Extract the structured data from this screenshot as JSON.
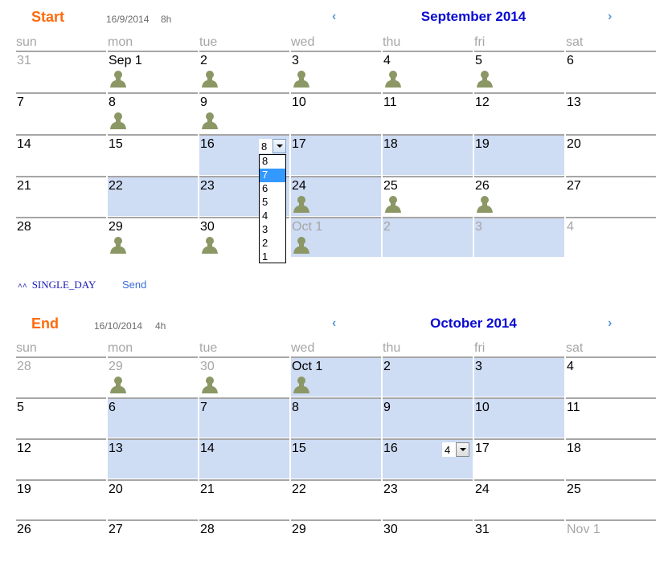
{
  "start": {
    "title": "Start",
    "date": "16/9/2014",
    "hours": "8h",
    "nav_prev": "‹",
    "nav_next": "›",
    "month": "September 2014",
    "weekdays": [
      "sun",
      "mon",
      "tue",
      "wed",
      "thu",
      "fri",
      "sat"
    ],
    "rows": [
      [
        {
          "label": "31",
          "other": true,
          "sel": false,
          "person": false
        },
        {
          "label": "Sep 1",
          "other": false,
          "sel": false,
          "person": true
        },
        {
          "label": "2",
          "other": false,
          "sel": false,
          "person": true
        },
        {
          "label": "3",
          "other": false,
          "sel": false,
          "person": true
        },
        {
          "label": "4",
          "other": false,
          "sel": false,
          "person": true
        },
        {
          "label": "5",
          "other": false,
          "sel": false,
          "person": true
        },
        {
          "label": "6",
          "other": false,
          "sel": false,
          "person": false
        }
      ],
      [
        {
          "label": "7",
          "other": false,
          "sel": false,
          "person": false
        },
        {
          "label": "8",
          "other": false,
          "sel": false,
          "person": true
        },
        {
          "label": "9",
          "other": false,
          "sel": false,
          "person": true
        },
        {
          "label": "10",
          "other": false,
          "sel": false,
          "person": false
        },
        {
          "label": "11",
          "other": false,
          "sel": false,
          "person": false
        },
        {
          "label": "12",
          "other": false,
          "sel": false,
          "person": false
        },
        {
          "label": "13",
          "other": false,
          "sel": false,
          "person": false
        }
      ],
      [
        {
          "label": "14",
          "other": false,
          "sel": false,
          "person": false
        },
        {
          "label": "15",
          "other": false,
          "sel": false,
          "person": false
        },
        {
          "label": "16",
          "other": false,
          "sel": true,
          "person": false
        },
        {
          "label": "17",
          "other": false,
          "sel": true,
          "person": false
        },
        {
          "label": "18",
          "other": false,
          "sel": true,
          "person": false
        },
        {
          "label": "19",
          "other": false,
          "sel": true,
          "person": false
        },
        {
          "label": "20",
          "other": false,
          "sel": false,
          "person": false
        }
      ],
      [
        {
          "label": "21",
          "other": false,
          "sel": false,
          "person": false
        },
        {
          "label": "22",
          "other": false,
          "sel": true,
          "person": false
        },
        {
          "label": "23",
          "other": false,
          "sel": true,
          "person": false
        },
        {
          "label": "24",
          "other": false,
          "sel": true,
          "person": true
        },
        {
          "label": "25",
          "other": false,
          "sel": false,
          "person": true
        },
        {
          "label": "26",
          "other": false,
          "sel": false,
          "person": true
        },
        {
          "label": "27",
          "other": false,
          "sel": false,
          "person": false
        }
      ],
      [
        {
          "label": "28",
          "other": false,
          "sel": false,
          "person": false
        },
        {
          "label": "29",
          "other": false,
          "sel": false,
          "person": true
        },
        {
          "label": "30",
          "other": false,
          "sel": false,
          "person": true
        },
        {
          "label": "Oct 1",
          "other": true,
          "sel": true,
          "person": true
        },
        {
          "label": "2",
          "other": true,
          "sel": true,
          "person": false
        },
        {
          "label": "3",
          "other": true,
          "sel": true,
          "person": false
        },
        {
          "label": "4",
          "other": true,
          "sel": false,
          "person": false
        }
      ]
    ],
    "hours_select": {
      "value": "8",
      "options": [
        "8",
        "7",
        "6",
        "5",
        "4",
        "3",
        "2",
        "1"
      ],
      "highlighted": "7"
    }
  },
  "footer": {
    "mode_icon": "double-chevron-up-icon",
    "mode_label": "SINGLE_DAY",
    "send_label": "Send"
  },
  "end": {
    "title": "End",
    "date": "16/10/2014",
    "hours": "4h",
    "nav_prev": "‹",
    "nav_next": "›",
    "month": "October 2014",
    "weekdays": [
      "sun",
      "mon",
      "tue",
      "wed",
      "thu",
      "fri",
      "sat"
    ],
    "rows": [
      [
        {
          "label": "28",
          "other": true,
          "sel": false,
          "person": false
        },
        {
          "label": "29",
          "other": true,
          "sel": false,
          "person": true
        },
        {
          "label": "30",
          "other": true,
          "sel": false,
          "person": true
        },
        {
          "label": "Oct 1",
          "other": false,
          "sel": true,
          "person": true
        },
        {
          "label": "2",
          "other": false,
          "sel": true,
          "person": false
        },
        {
          "label": "3",
          "other": false,
          "sel": true,
          "person": false
        },
        {
          "label": "4",
          "other": false,
          "sel": false,
          "person": false
        }
      ],
      [
        {
          "label": "5",
          "other": false,
          "sel": false,
          "person": false
        },
        {
          "label": "6",
          "other": false,
          "sel": true,
          "person": false
        },
        {
          "label": "7",
          "other": false,
          "sel": true,
          "person": false
        },
        {
          "label": "8",
          "other": false,
          "sel": true,
          "person": false
        },
        {
          "label": "9",
          "other": false,
          "sel": true,
          "person": false
        },
        {
          "label": "10",
          "other": false,
          "sel": true,
          "person": false
        },
        {
          "label": "11",
          "other": false,
          "sel": false,
          "person": false
        }
      ],
      [
        {
          "label": "12",
          "other": false,
          "sel": false,
          "person": false
        },
        {
          "label": "13",
          "other": false,
          "sel": true,
          "person": false
        },
        {
          "label": "14",
          "other": false,
          "sel": true,
          "person": false
        },
        {
          "label": "15",
          "other": false,
          "sel": true,
          "person": false
        },
        {
          "label": "16",
          "other": false,
          "sel": true,
          "person": false
        },
        {
          "label": "17",
          "other": false,
          "sel": false,
          "person": false
        },
        {
          "label": "18",
          "other": false,
          "sel": false,
          "person": false
        }
      ],
      [
        {
          "label": "19",
          "other": false,
          "sel": false,
          "person": false
        },
        {
          "label": "20",
          "other": false,
          "sel": false,
          "person": false
        },
        {
          "label": "21",
          "other": false,
          "sel": false,
          "person": false
        },
        {
          "label": "22",
          "other": false,
          "sel": false,
          "person": false
        },
        {
          "label": "23",
          "other": false,
          "sel": false,
          "person": false
        },
        {
          "label": "24",
          "other": false,
          "sel": false,
          "person": false
        },
        {
          "label": "25",
          "other": false,
          "sel": false,
          "person": false
        }
      ],
      [
        {
          "label": "26",
          "other": false,
          "sel": false,
          "person": false
        },
        {
          "label": "27",
          "other": false,
          "sel": false,
          "person": false
        },
        {
          "label": "28",
          "other": false,
          "sel": false,
          "person": false
        },
        {
          "label": "29",
          "other": false,
          "sel": false,
          "person": false
        },
        {
          "label": "30",
          "other": false,
          "sel": false,
          "person": false
        },
        {
          "label": "31",
          "other": false,
          "sel": false,
          "person": false
        },
        {
          "label": "Nov 1",
          "other": true,
          "sel": false,
          "person": false
        }
      ]
    ],
    "hours_select": {
      "value": "4"
    }
  }
}
